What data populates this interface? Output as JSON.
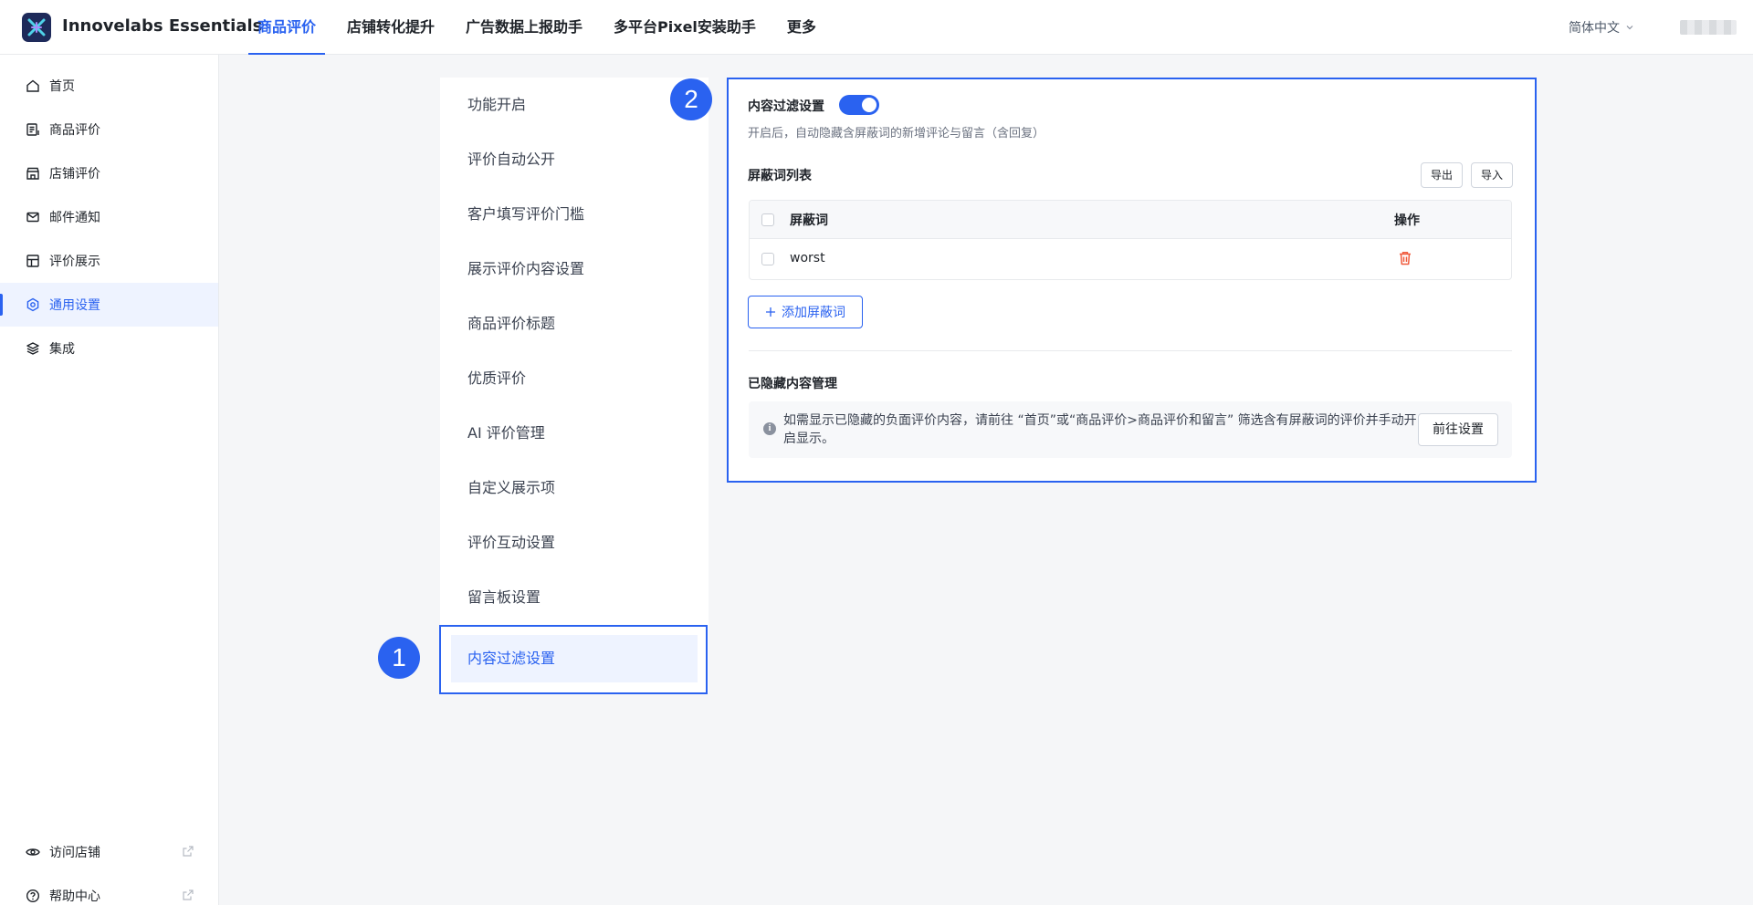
{
  "app": {
    "name": "Innovelabs Essentials"
  },
  "topnav": {
    "items": [
      {
        "label": "商品评价",
        "active": true
      },
      {
        "label": "店铺转化提升"
      },
      {
        "label": "广告数据上报助手"
      },
      {
        "label": "多平台Pixel安装助手"
      },
      {
        "label": "更多"
      }
    ],
    "language": "简体中文"
  },
  "sidebar": {
    "items": [
      {
        "label": "首页",
        "icon": "home-icon"
      },
      {
        "label": "商品评价",
        "icon": "review-list-icon"
      },
      {
        "label": "店铺评价",
        "icon": "store-icon"
      },
      {
        "label": "邮件通知",
        "icon": "mail-icon"
      },
      {
        "label": "评价展示",
        "icon": "layout-icon"
      },
      {
        "label": "通用设置",
        "icon": "settings-icon",
        "active": true
      },
      {
        "label": "集成",
        "icon": "layers-icon"
      }
    ],
    "footer": [
      {
        "label": "访问店铺",
        "icon": "eye-icon"
      },
      {
        "label": "帮助中心",
        "icon": "help-icon"
      }
    ]
  },
  "submenu": {
    "items": [
      "功能开启",
      "评价自动公开",
      "客户填写评价门槛",
      "展示评价内容设置",
      "商品评价标题",
      "优质评价",
      "AI 评价管理",
      "自定义展示项",
      "评价互动设置",
      "留言板设置",
      "内容过滤设置"
    ],
    "active": "内容过滤设置"
  },
  "callouts": {
    "one": "1",
    "two": "2"
  },
  "filter": {
    "title": "内容过滤设置",
    "enabled": true,
    "description": "开启后，自动隐藏含屏蔽词的新增评论与留言（含回复）",
    "list_title": "屏蔽词列表",
    "export_label": "导出",
    "import_label": "导入",
    "table": {
      "columns": [
        "屏蔽词",
        "操作"
      ],
      "rows": [
        {
          "word": "worst"
        }
      ]
    },
    "add_label": "添加屏蔽词",
    "hidden_title": "已隐藏内容管理",
    "notice": "如需显示已隐藏的负面评价内容，请前往 “首页”或“商品评价>商品评价和留言” 筛选含有屏蔽词的评价并手动开启显示。",
    "goto_label": "前往设置"
  },
  "colors": {
    "accent": "#2a62f0",
    "danger": "#f05a3c"
  }
}
